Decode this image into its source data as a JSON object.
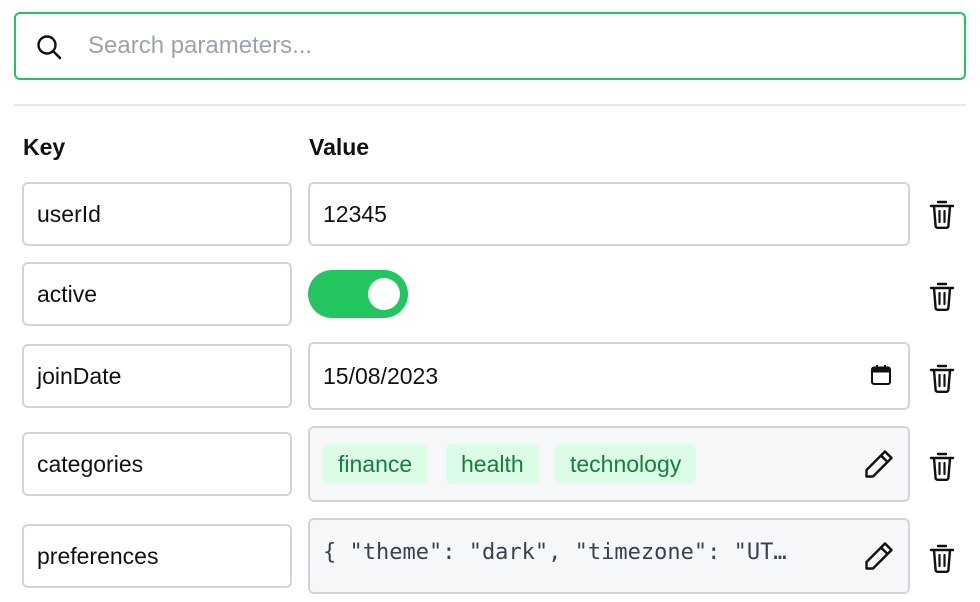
{
  "search": {
    "placeholder": "Search parameters..."
  },
  "headers": {
    "key": "Key",
    "value": "Value"
  },
  "rows": [
    {
      "key": "userId",
      "type": "text",
      "value": "12345"
    },
    {
      "key": "active",
      "type": "boolean",
      "value": true
    },
    {
      "key": "joinDate",
      "type": "date",
      "value": "15/08/2023"
    },
    {
      "key": "categories",
      "type": "array",
      "tags": [
        "finance",
        "health",
        "technology"
      ]
    },
    {
      "key": "preferences",
      "type": "object",
      "value": "{ \"theme\": \"dark\", \"timezone\": \"UT…"
    }
  ],
  "colors": {
    "accent": "#22c55e",
    "tag_bg": "#dcfce7",
    "tag_text": "#15803d",
    "border": "#d1d5db"
  },
  "icons": {
    "search": "search-icon",
    "delete": "trash-icon",
    "edit": "pencil-icon",
    "calendar": "calendar-icon"
  }
}
